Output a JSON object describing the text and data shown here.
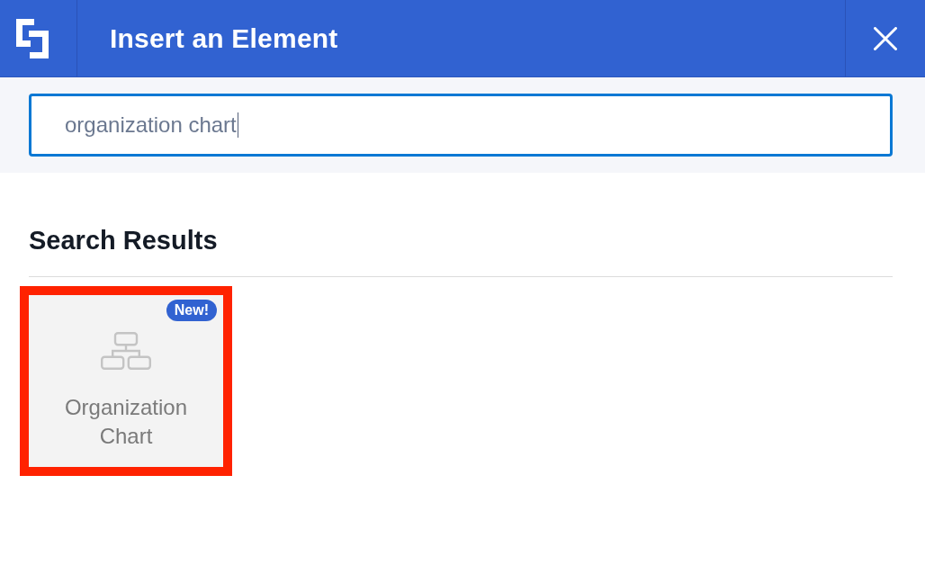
{
  "window": {
    "title": "Insert an Element"
  },
  "search": {
    "value": "organization chart",
    "focused": true
  },
  "results": {
    "heading": "Search Results",
    "items": [
      {
        "label": "Organization Chart",
        "badge": "New!",
        "highlighted": true
      }
    ]
  }
}
